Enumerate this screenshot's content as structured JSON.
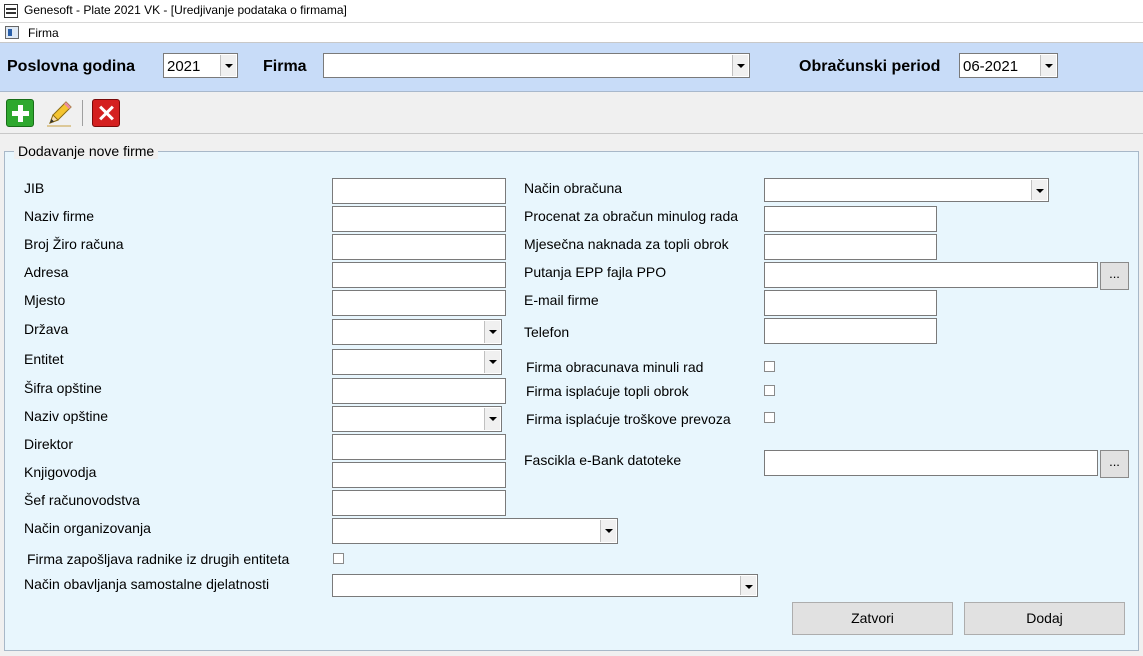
{
  "window": {
    "title": "Genesoft - Plate 2021 VK - [Uredjivanje podataka o firmama]"
  },
  "menu": {
    "firma": "Firma"
  },
  "filter": {
    "godina_label": "Poslovna godina",
    "godina_value": "2021",
    "firma_label": "Firma",
    "firma_value": "",
    "period_label": "Obračunski period",
    "period_value": "06-2021"
  },
  "toolbar": {
    "add": "add-icon",
    "edit": "pencil-icon",
    "delete": "delete-icon"
  },
  "form": {
    "group_title": "Dodavanje nove firme",
    "left": {
      "jib": "JIB",
      "naziv_firme": "Naziv firme",
      "ziro": "Broj Žiro računa",
      "adresa": "Adresa",
      "mjesto": "Mjesto",
      "drzava": "Država",
      "entitet": "Entitet",
      "sifra_opstine": "Šifra opštine",
      "naziv_opstine": "Naziv opštine",
      "direktor": "Direktor",
      "knjigovodja": "Knjigovodja",
      "sef": "Šef računovodstva",
      "nacin_org": "Način organizovanja",
      "firma_zaposljava": "Firma zapošljava radnike iz drugih entiteta",
      "nacin_samostalne": "Način obavljanja samostalne djelatnosti"
    },
    "right": {
      "nacin_obracuna": "Način obračuna",
      "procenat": "Procenat za obračun minulog rada",
      "naknada": "Mjesečna naknada za topli obrok",
      "putanja": "Putanja EPP fajla PPO",
      "email": "E-mail firme",
      "telefon": "Telefon",
      "minuli_rad": "Firma obracunava minuli rad",
      "topli_obrok": "Firma isplaćuje topli obrok",
      "prevoz": "Firma isplaćuje troškove prevoza",
      "fascikla": "Fascikla e-Bank datoteke"
    },
    "browse": "...",
    "buttons": {
      "zatvori": "Zatvori",
      "dodaj": "Dodaj"
    }
  }
}
